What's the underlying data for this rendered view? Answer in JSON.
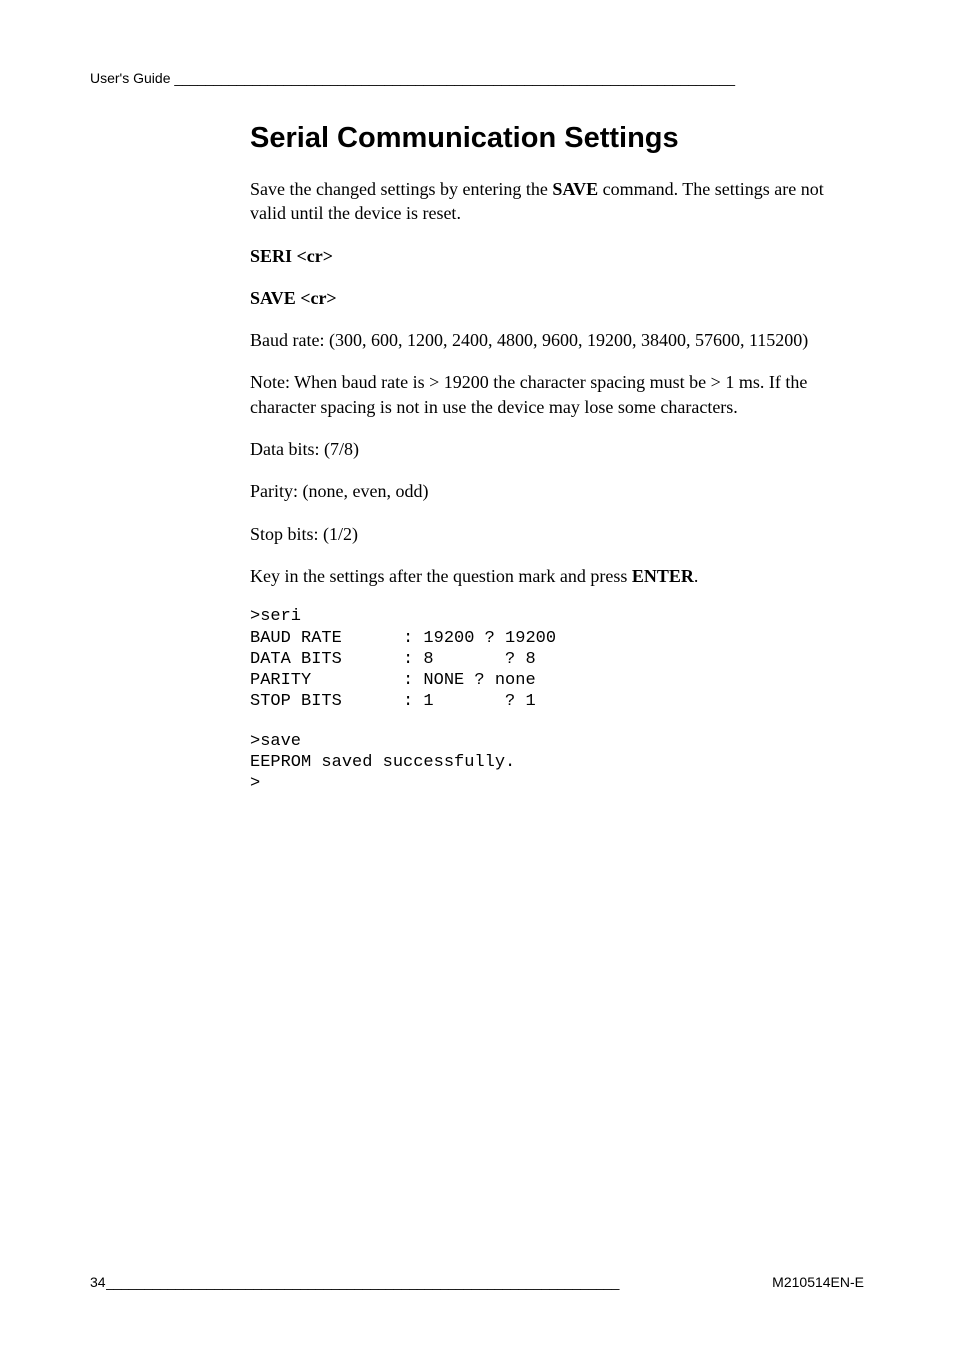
{
  "header": {
    "label": "User's Guide",
    "rule": " ________________________________________________________________________"
  },
  "title": "Serial Communication Settings",
  "paragraphs": {
    "intro_pre": "Save the changed settings by entering the ",
    "intro_cmd": "SAVE",
    "intro_post": " command. The settings are not valid until the device is reset.",
    "seri": "SERI <cr>",
    "save": "SAVE <cr>",
    "baud": "Baud rate: (300, 600, 1200, 2400, 4800, 9600, 19200, 38400, 57600, 115200)",
    "note": "Note: When baud rate is > 19200 the character spacing must be > 1 ms. If the character spacing is not in use the device may lose some characters.",
    "databits": "Data bits: (7/8)",
    "parity": "Parity: (none, even, odd)",
    "stopbits": "Stop bits: (1/2)",
    "keyin_pre": "Key in the settings after the question mark and press ",
    "keyin_cmd": "ENTER",
    "keyin_post": "."
  },
  "terminal1": ">seri\nBAUD RATE      : 19200 ? 19200\nDATA BITS      : 8       ? 8\nPARITY         : NONE ? none\nSTOP BITS      : 1       ? 1",
  "terminal2": ">save\nEEPROM saved successfully.\n>",
  "footer": {
    "page": "34",
    "rule": " __________________________________________________________________",
    "docid": "M210514EN-E"
  }
}
